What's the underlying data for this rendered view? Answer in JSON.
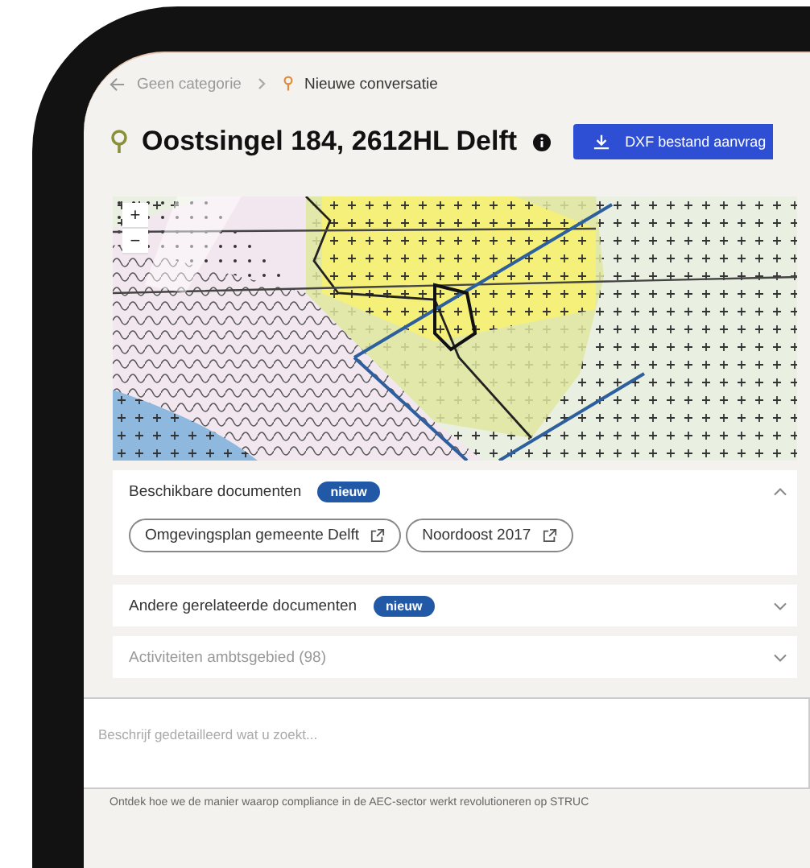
{
  "breadcrumb": {
    "items": [
      {
        "label": "Geen categorie",
        "kind": "category"
      },
      {
        "label": "Nieuwe conversatie",
        "kind": "pin"
      }
    ]
  },
  "title": "Oostsingel 184, 2612HL Delft",
  "action_button": "DXF bestand aanvrag",
  "map": {
    "zoom_in": "+",
    "zoom_out": "−"
  },
  "sections": [
    {
      "title": "Beschikbare documenten",
      "badge": "nieuw",
      "expanded": true,
      "disabled": false,
      "links": [
        "Omgevingsplan gemeente Delft",
        "Noordoost 2017"
      ]
    },
    {
      "title": "Andere gerelateerde documenten",
      "badge": "nieuw",
      "expanded": false,
      "disabled": false
    },
    {
      "title": "Activiteiten ambtsgebied (98)",
      "expanded": false,
      "disabled": true
    }
  ],
  "prompt": {
    "placeholder": "Beschrijf gedetailleerd wat u zoekt..."
  },
  "footer": "Ontdek hoe we de manier waarop compliance in de AEC-sector werkt revolutioneren op STRUC"
}
